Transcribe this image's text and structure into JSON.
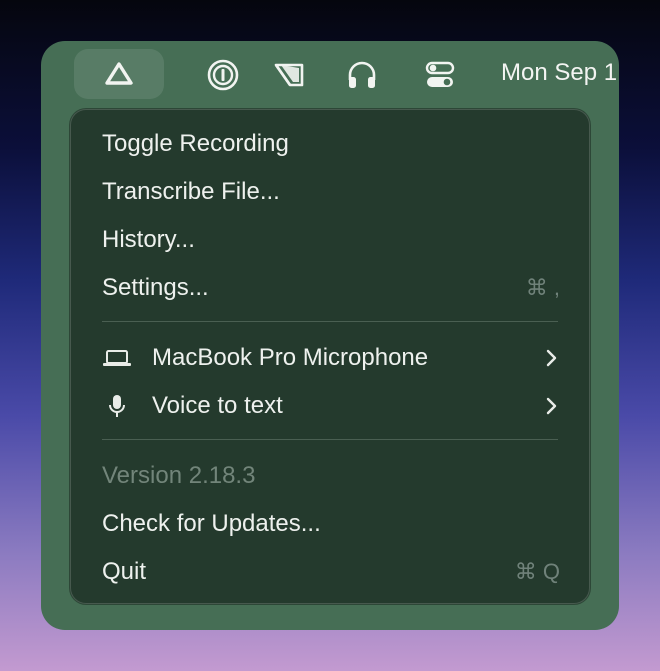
{
  "menubar": {
    "icons": [
      {
        "name": "app-triangle-icon"
      },
      {
        "name": "password-manager-icon"
      },
      {
        "name": "shortcuts-app-icon"
      },
      {
        "name": "headphones-icon"
      },
      {
        "name": "control-center-icon"
      }
    ],
    "clock": "Mon Sep 1"
  },
  "menu": {
    "items": [
      {
        "label": "Toggle Recording"
      },
      {
        "label": "Transcribe File..."
      },
      {
        "label": "History..."
      },
      {
        "label": "Settings...",
        "shortcut": "⌘ ,"
      },
      {
        "label": "MacBook Pro Microphone",
        "icon": "laptop-icon"
      },
      {
        "label": "Voice to text",
        "icon": "microphone-icon"
      },
      {
        "label": "Version 2.18.3",
        "disabled": true
      },
      {
        "label": "Check for Updates..."
      },
      {
        "label": "Quit",
        "shortcut": "⌘ Q"
      }
    ]
  },
  "colors": {
    "panel": "#466e55",
    "menu_bg": "#243a2d",
    "text": "#eef1ee",
    "muted": "#72857a"
  }
}
